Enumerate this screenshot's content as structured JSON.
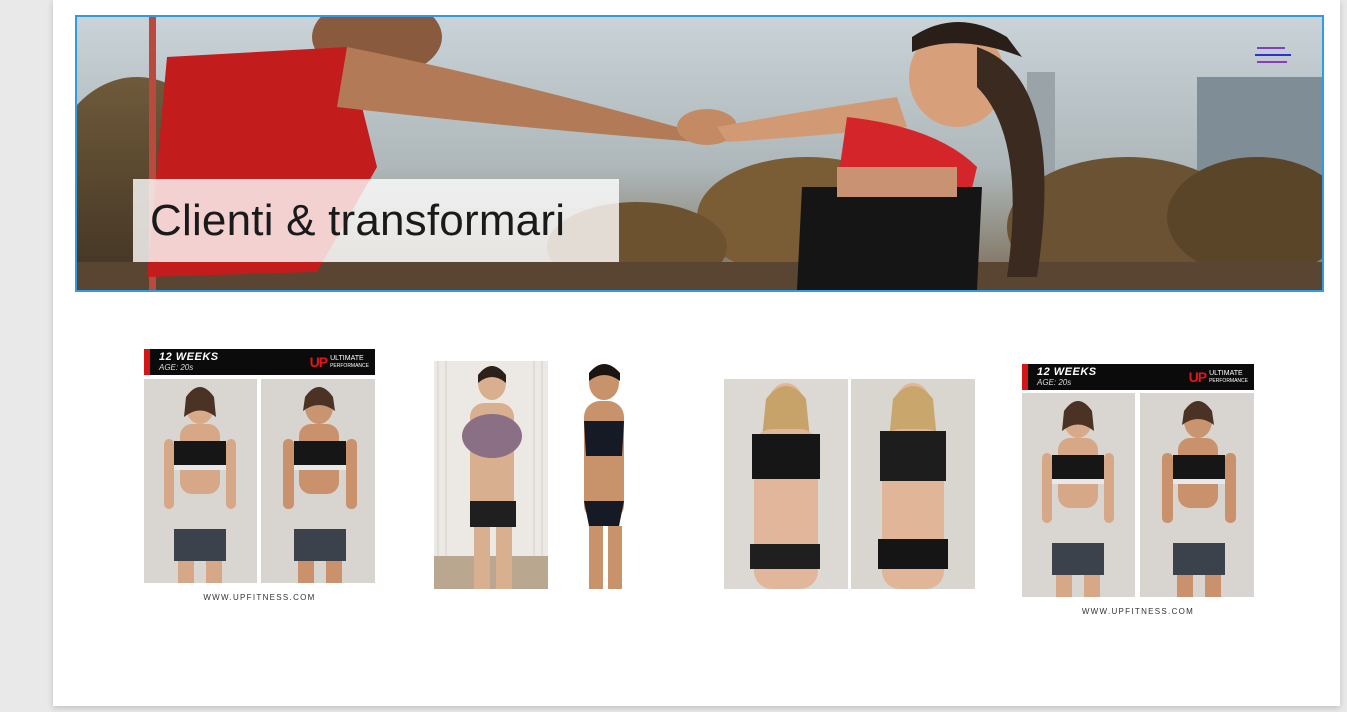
{
  "hero": {
    "title": "Clienti & transformari"
  },
  "menu": {
    "icon": "hamburger-menu-icon"
  },
  "gallery": [
    {
      "weeks": "12 WEEKS",
      "age": "AGE: 20s",
      "brand_mark": "UP",
      "brand_line1": "ULTIMATE",
      "brand_line2": "PERFORMANCE",
      "caption": "WWW.UPFITNESS.COM"
    },
    {
      "alt": "before-after-swimwear"
    },
    {
      "alt": "before-after-underwear"
    },
    {
      "weeks": "12 WEEKS",
      "age": "AGE: 20s",
      "brand_mark": "UP",
      "brand_line1": "ULTIMATE",
      "brand_line2": "PERFORMANCE",
      "caption": "WWW.UPFITNESS.COM"
    }
  ],
  "colors": {
    "accent_border": "#2e9be6",
    "brand_red": "#d4161b",
    "menu_purple": "#5b2aa8"
  }
}
